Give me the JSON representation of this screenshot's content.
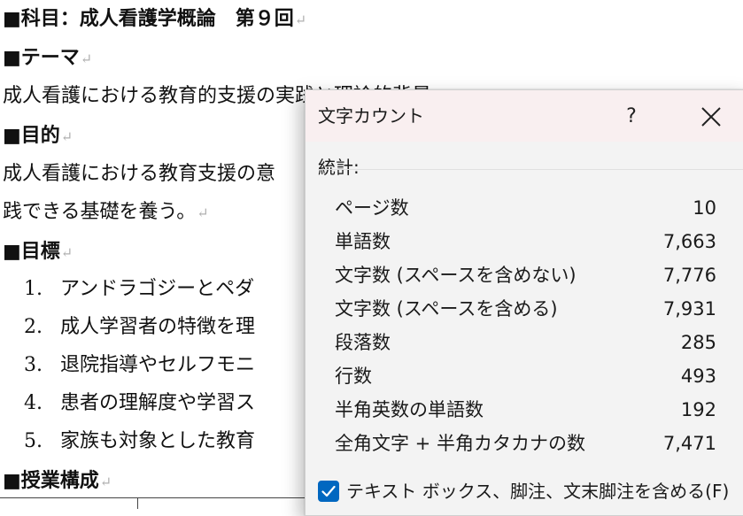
{
  "document": {
    "lines": [
      {
        "text": "■科目：成人看護学概論　第９回",
        "bold": true
      },
      {
        "text": "■テーマ",
        "bold": true
      },
      {
        "text": "成人看護における教育的支援の実践と理論的背景",
        "bold": false
      },
      {
        "text": "■目的",
        "bold": true
      },
      {
        "text": "成人看護における教育支援の意",
        "bold": false
      },
      {
        "text": "践できる基礎を養う。",
        "bold": false
      },
      {
        "text": "■目標",
        "bold": true
      },
      {
        "text": "1.",
        "item": "アンドラゴジーとペダ"
      },
      {
        "text": "2.",
        "item": "成人学習者の特徴を理"
      },
      {
        "text": "3.",
        "item": "退院指導やセルフモニ"
      },
      {
        "text": "4.",
        "item": "患者の理解度や学習ス"
      },
      {
        "text": "5.",
        "item": "家族も対象とした教育"
      },
      {
        "text": "■授業構成",
        "bold": true
      }
    ],
    "paragraph_mark": "↵"
  },
  "dialog": {
    "title": "文字カウント",
    "help_label": "?",
    "section_label": "統計:",
    "stats": [
      {
        "name": "ページ数",
        "value": "10"
      },
      {
        "name": "単語数",
        "value": "7,663"
      },
      {
        "name": "文字数 (スペースを含めない)",
        "value": "7,776"
      },
      {
        "name": "文字数 (スペースを含める)",
        "value": "7,931"
      },
      {
        "name": "段落数",
        "value": "285"
      },
      {
        "name": "行数",
        "value": "493"
      },
      {
        "name": "半角英数の単語数",
        "value": "192"
      },
      {
        "name": "全角文字 + 半角カタカナの数",
        "value": "7,471"
      }
    ],
    "checkbox": {
      "label": "テキスト ボックス、脚注、文末脚注を含める(F)",
      "checked": true
    },
    "colors": {
      "accent": "#0067c0",
      "titlebar": "#f9eff0"
    }
  }
}
